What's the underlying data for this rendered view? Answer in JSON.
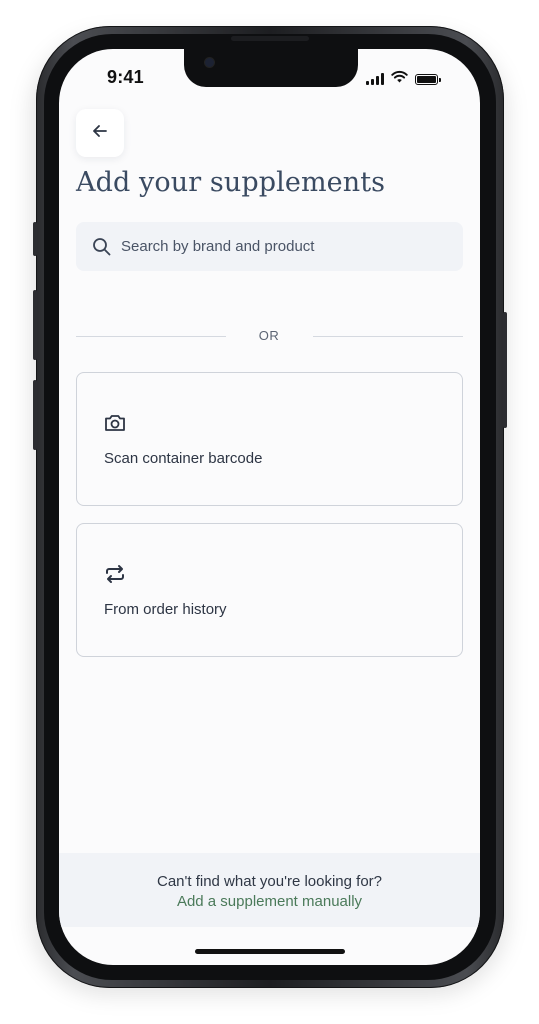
{
  "status_bar": {
    "time": "9:41"
  },
  "header": {
    "title": "Add your supplements"
  },
  "search": {
    "placeholder": "Search by brand and product"
  },
  "divider": {
    "label": "OR"
  },
  "options": [
    {
      "label": "Scan container barcode",
      "icon": "camera-icon"
    },
    {
      "label": "From order history",
      "icon": "repeat-icon"
    }
  ],
  "footer": {
    "question": "Can't find what you're looking for?",
    "link": "Add a supplement manually"
  },
  "colors": {
    "title": "#3a4a61",
    "link": "#4b7a5a",
    "search_bg": "#f1f3f7",
    "card_border": "#cfd3da"
  }
}
